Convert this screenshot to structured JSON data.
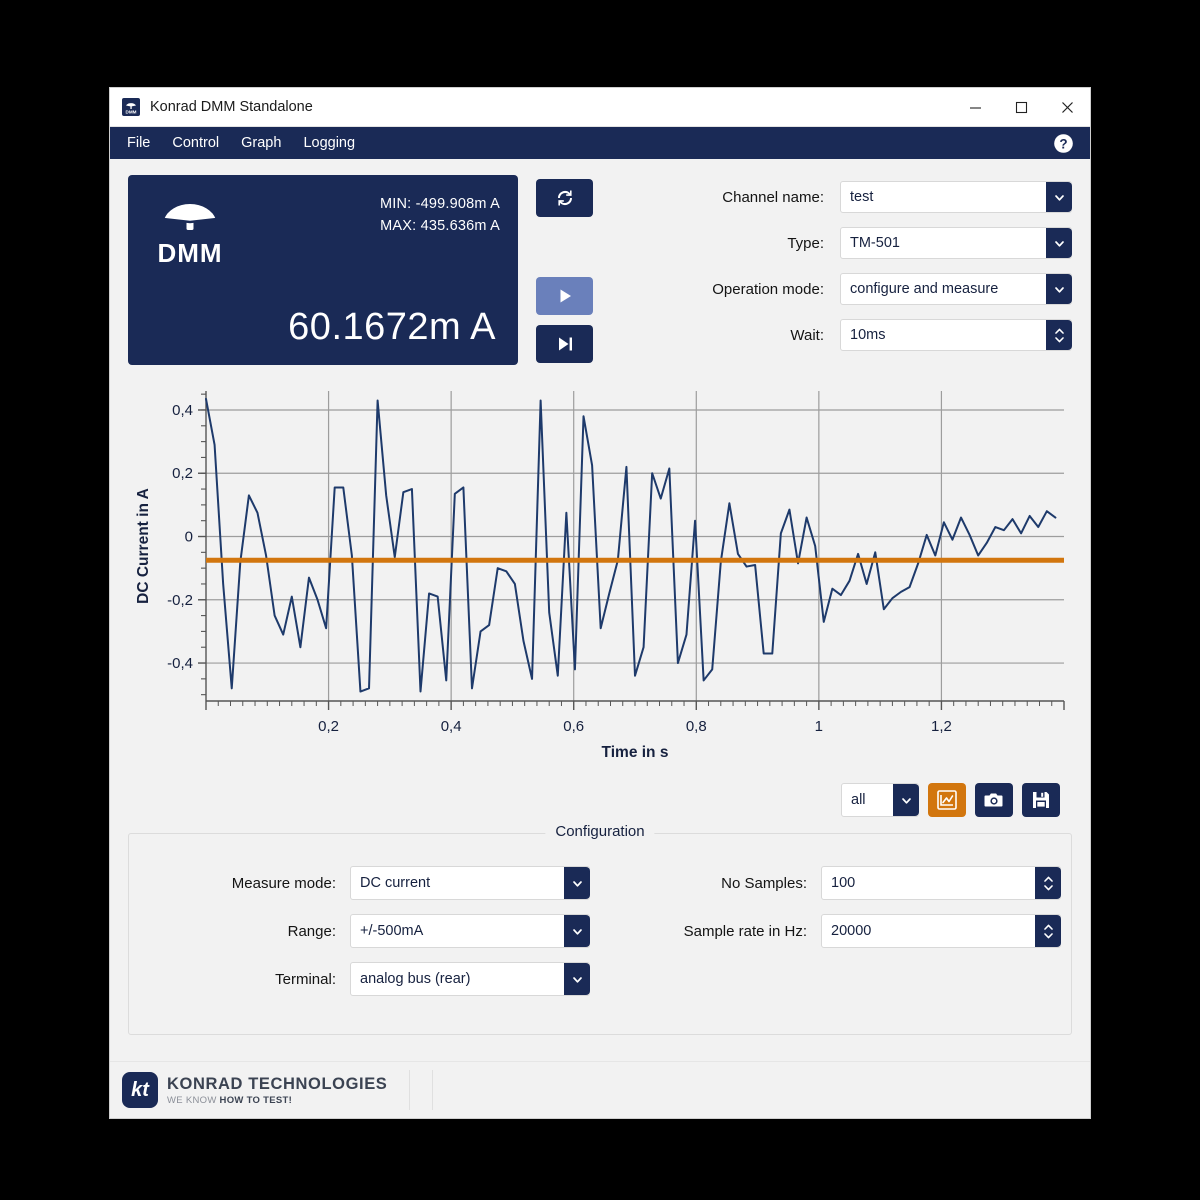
{
  "window": {
    "title": "Konrad DMM Standalone",
    "icon": "dmm-app-icon",
    "minimize_label": "–",
    "maximize_label": "□",
    "close_label": "✕"
  },
  "menubar": {
    "items": [
      {
        "label": "File"
      },
      {
        "label": "Control"
      },
      {
        "label": "Graph"
      },
      {
        "label": "Logging"
      }
    ],
    "help_icon": "help-circle-icon"
  },
  "dmm": {
    "logo_text": "DMM",
    "min_label": "MIN: -499.908m A",
    "max_label": "MAX: 435.636m A",
    "value": "60.1672m A"
  },
  "controls": {
    "refresh_icon": "refresh-icon",
    "run_icon": "play-icon",
    "step_icon": "step-forward-icon"
  },
  "channel_form": {
    "rows": [
      {
        "label": "Channel name:",
        "value": "test",
        "kind": "combo"
      },
      {
        "label": "Type:",
        "value": "TM-501",
        "kind": "combo"
      },
      {
        "label": "Operation mode:",
        "value": "configure and measure",
        "kind": "combo"
      },
      {
        "label": "Wait:",
        "value": "10ms",
        "kind": "spinner"
      }
    ]
  },
  "chart_tools": {
    "select_value": "all",
    "graph_icon": "graph-cursor-icon",
    "camera_icon": "camera-icon",
    "save_icon": "floppy-save-icon"
  },
  "configuration": {
    "title": "Configuration",
    "left_rows": [
      {
        "label": "Measure mode:",
        "value": "DC current",
        "kind": "combo"
      },
      {
        "label": "Range:",
        "value": "+/-500mA",
        "kind": "combo"
      },
      {
        "label": "Terminal:",
        "value": "analog bus (rear)",
        "kind": "combo"
      }
    ],
    "right_rows": [
      {
        "label": "No Samples:",
        "value": "100",
        "kind": "spinner"
      },
      {
        "label": "Sample rate in Hz:",
        "value": "20000",
        "kind": "spinner"
      }
    ]
  },
  "footer": {
    "logo_mark": "kt",
    "company": "KONRAD TECHNOLOGIES",
    "tagline_light": "WE KNOW ",
    "tagline_bold": "HOW TO TEST!"
  },
  "colors": {
    "navy": "#1a2a56",
    "orange": "#d2760e",
    "trace": "#1e3a6b",
    "panel_bg": "#f2f2f2"
  },
  "chart_data": {
    "type": "line",
    "title": "",
    "xlabel": "Time in s",
    "ylabel": "DC Current in A",
    "xlim": [
      0.0,
      1.4
    ],
    "ylim": [
      -0.52,
      0.46
    ],
    "xticks": [
      0.2,
      0.4,
      0.6,
      0.8,
      1.0,
      1.2
    ],
    "xtick_labels": [
      "0,2",
      "0,4",
      "0,6",
      "0,8",
      "1",
      "1,2"
    ],
    "yticks": [
      0.4,
      0.2,
      0.0,
      -0.2,
      -0.4
    ],
    "ytick_labels": [
      "0,4",
      "0,2",
      "0",
      "-0,2",
      "-0,4"
    ],
    "grid": true,
    "legend": "none",
    "series": [
      {
        "name": "DC Current",
        "color": "#1e3a6b",
        "x": [
          0.0,
          0.014,
          0.028,
          0.042,
          0.056,
          0.07,
          0.084,
          0.098,
          0.112,
          0.126,
          0.14,
          0.154,
          0.168,
          0.182,
          0.196,
          0.21,
          0.224,
          0.238,
          0.252,
          0.266,
          0.28,
          0.294,
          0.308,
          0.322,
          0.336,
          0.35,
          0.364,
          0.378,
          0.392,
          0.406,
          0.42,
          0.434,
          0.448,
          0.462,
          0.476,
          0.49,
          0.504,
          0.518,
          0.532,
          0.546,
          0.56,
          0.574,
          0.588,
          0.602,
          0.616,
          0.63,
          0.644,
          0.658,
          0.672,
          0.686,
          0.7,
          0.714,
          0.728,
          0.742,
          0.756,
          0.77,
          0.784,
          0.798,
          0.812,
          0.826,
          0.84,
          0.854,
          0.868,
          0.882,
          0.896,
          0.91,
          0.924,
          0.938,
          0.952,
          0.966,
          0.98,
          0.994,
          1.008,
          1.022,
          1.036,
          1.05,
          1.064,
          1.078,
          1.092,
          1.106,
          1.12,
          1.134,
          1.148,
          1.162,
          1.176,
          1.19,
          1.204,
          1.218,
          1.232,
          1.246,
          1.26,
          1.274,
          1.288,
          1.302,
          1.316,
          1.33,
          1.344,
          1.358,
          1.372,
          1.386
        ],
        "y": [
          0.435,
          0.29,
          -0.15,
          -0.48,
          -0.08,
          0.13,
          0.075,
          -0.06,
          -0.25,
          -0.31,
          -0.19,
          -0.35,
          -0.13,
          -0.2,
          -0.29,
          0.155,
          0.155,
          -0.06,
          -0.49,
          -0.48,
          0.43,
          0.13,
          -0.065,
          0.14,
          0.15,
          -0.49,
          -0.18,
          -0.19,
          -0.455,
          0.135,
          0.155,
          -0.48,
          -0.3,
          -0.28,
          -0.1,
          -0.11,
          -0.15,
          -0.33,
          -0.45,
          0.43,
          -0.24,
          -0.44,
          0.075,
          -0.42,
          0.38,
          0.225,
          -0.29,
          -0.18,
          -0.075,
          0.22,
          -0.44,
          -0.35,
          0.2,
          0.12,
          0.215,
          -0.4,
          -0.31,
          0.05,
          -0.455,
          -0.42,
          -0.08,
          0.105,
          -0.055,
          -0.095,
          -0.09,
          -0.37,
          -0.37,
          0.01,
          0.085,
          -0.085,
          0.06,
          -0.03,
          -0.27,
          -0.165,
          -0.185,
          -0.14,
          -0.055,
          -0.15,
          -0.05,
          -0.23,
          -0.195,
          -0.175,
          -0.16,
          -0.085,
          0.005,
          -0.06,
          0.045,
          -0.01,
          0.06,
          0.005,
          -0.06,
          -0.02,
          0.03,
          0.02,
          0.055,
          0.01,
          0.065,
          0.03,
          0.08,
          0.06
        ]
      },
      {
        "name": "Mean / Cursor",
        "color": "#d2760e",
        "type": "hline",
        "y_value": -0.075
      }
    ]
  }
}
